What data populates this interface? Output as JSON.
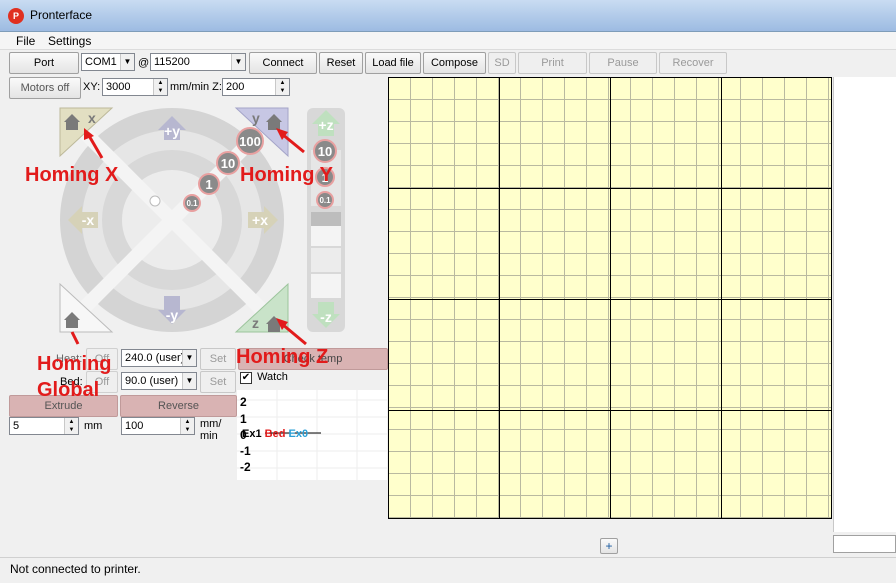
{
  "window": {
    "title": "Pronterface",
    "icon": "pronterface-app-icon"
  },
  "menu": {
    "file": "File",
    "settings": "Settings"
  },
  "toolbar": {
    "port_label": "Port",
    "port_value": "COM1",
    "at_sign": "@",
    "baud_value": "115200",
    "connect": "Connect",
    "reset": "Reset",
    "load_file": "Load file",
    "compose": "Compose",
    "sd": "SD",
    "print": "Print",
    "pause": "Pause",
    "recover": "Recover"
  },
  "motion": {
    "motors_off": "Motors off",
    "xy_label": "XY:",
    "xy_speed": "3000",
    "mm_min_z": "mm/min Z:",
    "z_speed": "200",
    "jog": {
      "plus_y": "+y",
      "minus_y": "-y",
      "plus_x": "+x",
      "minus_x": "-x",
      "home_x": "x",
      "home_y": "y",
      "home_z": "z",
      "plus_z": "+z",
      "minus_z": "-z",
      "step_100": "100",
      "step_10": "10",
      "step_1": "1",
      "step_01": "0.1",
      "z_step_10": "10",
      "z_step_1": "1",
      "z_step_01": "0.1"
    }
  },
  "annotations": {
    "homing_x": "Homing X",
    "homing_y": "Homing Y",
    "homing_z": "Homing Z",
    "homing_global": "Homing\nGlobal"
  },
  "temperature": {
    "heater_label": "Heat:",
    "heater_off": "Off",
    "heater_value": "240.0 (user)",
    "bed_label": "Bed:",
    "bed_off": "Off",
    "bed_value": "90.0 (user)",
    "set": "Set",
    "check_temp": "Check temp",
    "watch": "Watch"
  },
  "extrude": {
    "extrude": "Extrude",
    "reverse": "Reverse",
    "length": "5",
    "length_unit": "mm",
    "feed": "100",
    "feed_unit": "mm/\nmin"
  },
  "graph": {
    "ticks": [
      "2",
      "1",
      "0",
      "-1",
      "-2"
    ],
    "legend": {
      "ex1": "Ex1",
      "bed": "Bed",
      "ex0": "Ex0"
    },
    "colors": {
      "ex1": "#000000",
      "bed": "#e21b1b",
      "ex0": "#2a9fd6"
    }
  },
  "plate": {
    "zoom_button": "+"
  },
  "status": {
    "text": "Not connected to printer."
  },
  "colors": {
    "annotation": "#e21b1b",
    "plate_bg": "#ffffcc",
    "plate_grid": "#b9b9a0"
  }
}
